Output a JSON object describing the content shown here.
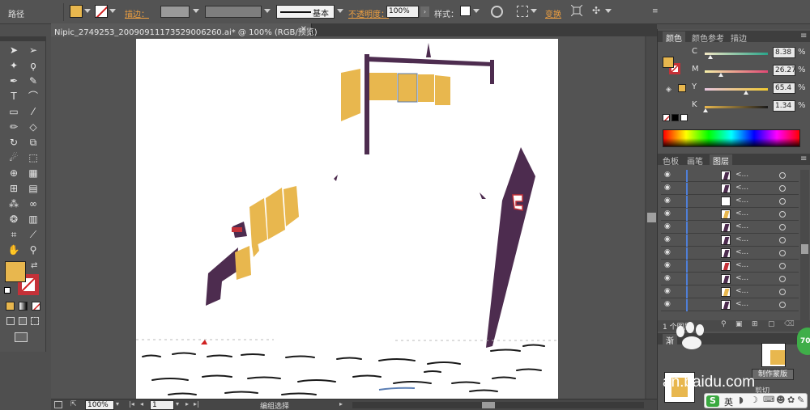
{
  "control_bar": {
    "selection_label": "路径",
    "stroke_label": "描边：",
    "stroke_style": "基本",
    "opacity_label": "不透明度：",
    "opacity_value": "100%",
    "style_label": "样式：",
    "transform_label": "变换"
  },
  "document_tab": {
    "title": "Nipic_2749253_20090911173529006260.ai* @ 100% (RGB/预览)",
    "close_glyph": "×"
  },
  "colors": {
    "fill": "#e8b74e",
    "ship_purple": "#4d2c4f",
    "ship_accent": "#c43138",
    "stroke_red": "#d02020"
  },
  "color_panel": {
    "tabs": [
      "颜色",
      "颜色参考",
      "描边"
    ],
    "channels": [
      {
        "label": "C",
        "value": "8.38",
        "fraction": 0.0838
      },
      {
        "label": "M",
        "value": "26.27",
        "fraction": 0.2627
      },
      {
        "label": "Y",
        "value": "65.4",
        "fraction": 0.654
      },
      {
        "label": "K",
        "value": "1.34",
        "fraction": 0.0134
      }
    ],
    "percent_glyph": "%"
  },
  "layers_panel": {
    "tabs": [
      "色板",
      "画笔",
      "图层"
    ],
    "item_label": "<...",
    "row_count": 11,
    "footer_label": "1 个图层"
  },
  "transparency_panel": {
    "tab_label": "渐",
    "make_mask_button": "制作蒙版",
    "clip_label": "剪切"
  },
  "status_bar": {
    "zoom": "100%",
    "page": "1",
    "mode": "编组选择"
  },
  "overlays": {
    "watermark": "an.baidu.com",
    "ime_label": "英",
    "badge": "70"
  }
}
